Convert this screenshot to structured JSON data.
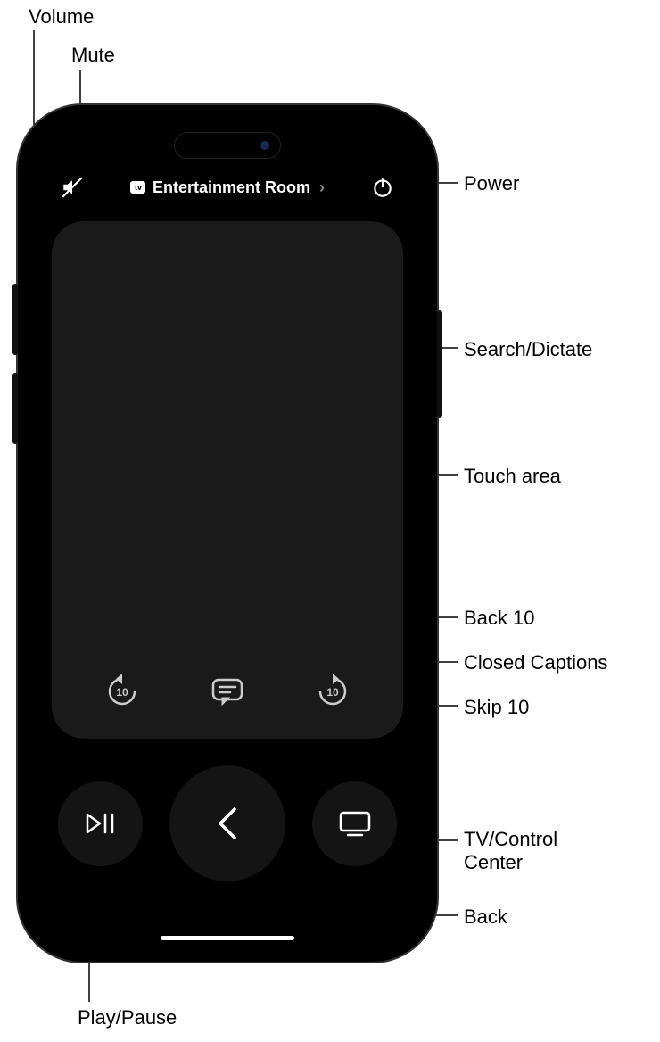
{
  "labels": {
    "volume": "Volume",
    "mute": "Mute",
    "power": "Power",
    "search_dictate": "Search/Dictate",
    "touch_area": "Touch area",
    "back_10": "Back 10",
    "closed_captions": "Closed Captions",
    "skip_10": "Skip 10",
    "tv_control_center": "TV/Control\nCenter",
    "back": "Back",
    "play_pause": "Play/Pause"
  },
  "device": {
    "badge": "tv",
    "name": "Entertainment Room"
  },
  "skip_value": "10"
}
